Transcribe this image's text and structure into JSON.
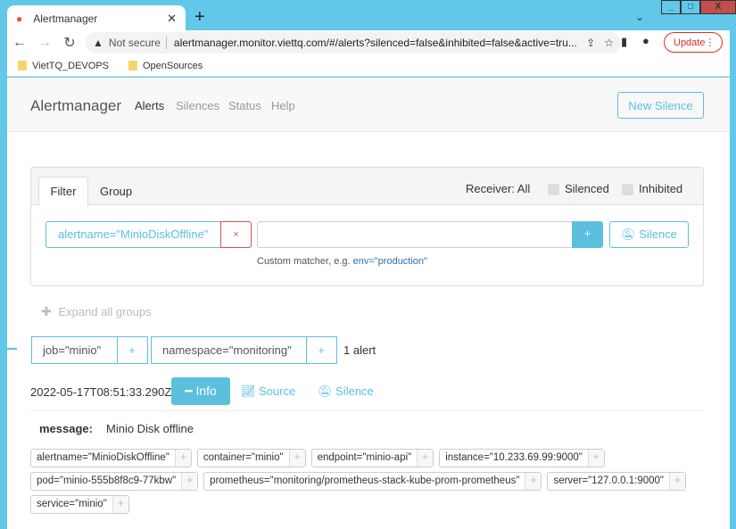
{
  "browser": {
    "tab_title": "Alertmanager",
    "not_secure": "Not secure",
    "url": "alertmanager.monitor.viettq.com/#/alerts?silenced=false&inhibited=false&active=tru...",
    "update": "Update",
    "bookmarks": [
      "VietTQ_DEVOPS",
      "OpenSources"
    ]
  },
  "navbar": {
    "brand": "Alertmanager",
    "links": [
      "Alerts",
      "Silences",
      "Status",
      "Help"
    ],
    "new_silence": "New Silence"
  },
  "filter": {
    "tabs": [
      "Filter",
      "Group"
    ],
    "receiver": "Receiver: All",
    "silenced": "Silenced",
    "inhibited": "Inhibited",
    "matcher": "alertname=\"MinioDiskOffline\"",
    "matcher_remove": "×",
    "add": "+",
    "silence": "Silence",
    "hint": "Custom matcher, e.g.",
    "hint_example": "env=\"production\"",
    "input_value": ""
  },
  "expand_all": "Expand all groups",
  "group": {
    "labels": [
      "job=\"minio\"",
      "namespace=\"monitoring\""
    ],
    "count": "1 alert"
  },
  "alert": {
    "timestamp": "2022-05-17T08:51:33.290Z",
    "info": "Info",
    "source": "Source",
    "silence": "Silence",
    "annotation_key": "message:",
    "annotation_value": "Minio Disk offline",
    "labels": [
      "alertname=\"MinioDiskOffline\"",
      "container=\"minio\"",
      "endpoint=\"minio-api\"",
      "instance=\"10.233.69.99:9000\"",
      "pod=\"minio-555b8f8c9-77kbw\"",
      "prometheus=\"monitoring/prometheus-stack-kube-prom-prometheus\"",
      "server=\"127.0.0.1:9000\"",
      "service=\"minio\""
    ]
  },
  "colors": {
    "accent": "#5bc0de",
    "danger": "#d9534f"
  }
}
